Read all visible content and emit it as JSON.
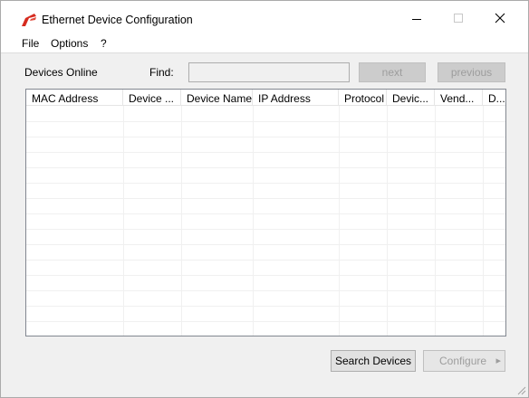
{
  "window": {
    "title": "Ethernet Device Configuration",
    "controls": {
      "minimize": "minimize-icon",
      "maximize": "maximize-icon",
      "close": "close-icon"
    },
    "accent_color": "#d62b1f"
  },
  "menu": {
    "file": "File",
    "options": "Options",
    "help": "?"
  },
  "toolbar": {
    "devices_online_label": "Devices Online",
    "find_label": "Find:",
    "find_value": "",
    "next_label": "next",
    "previous_label": "previous"
  },
  "table": {
    "columns": [
      "MAC Address",
      "Device ...",
      "Device Name",
      "IP Address",
      "Protocol",
      "Devic...",
      "Vend...",
      "D..."
    ],
    "rows": []
  },
  "footer": {
    "search_label": "Search Devices",
    "configure_label": "Configure",
    "configure_arrow": "▸"
  }
}
